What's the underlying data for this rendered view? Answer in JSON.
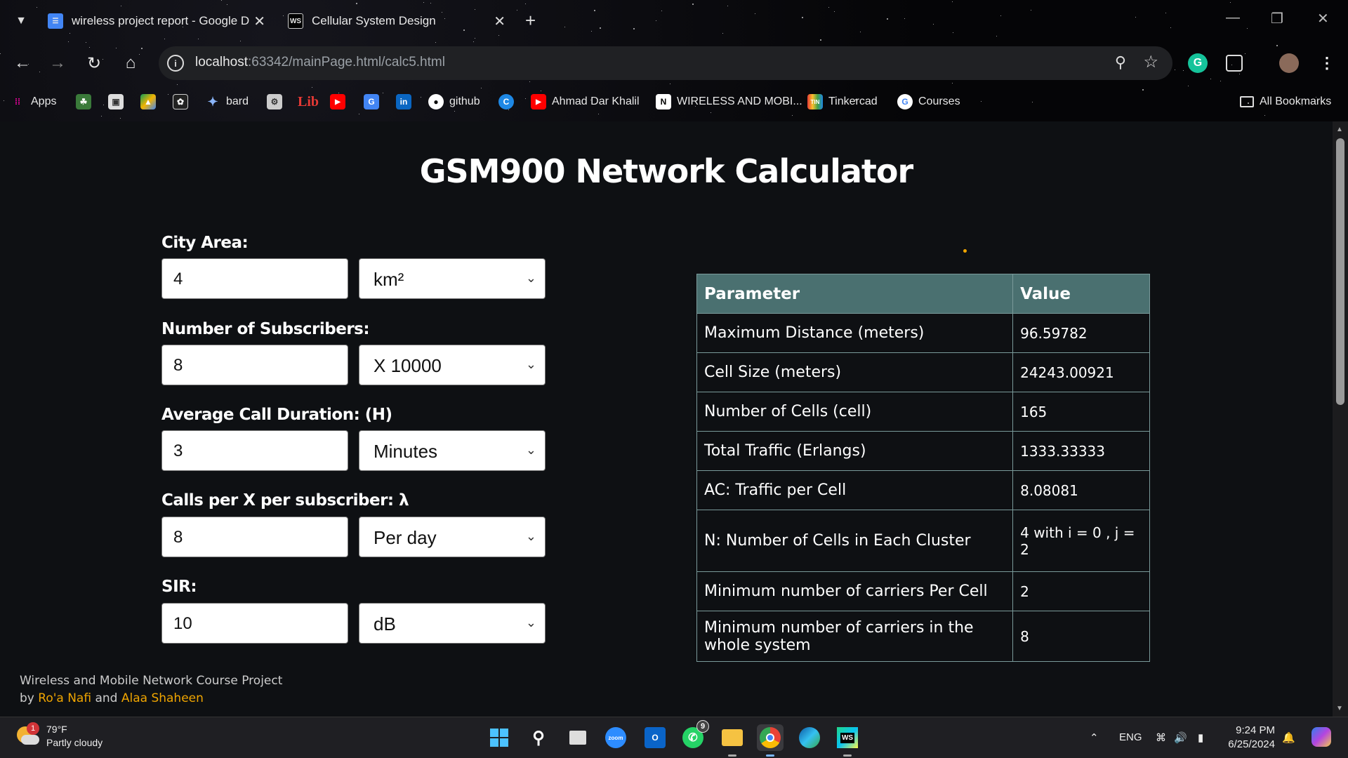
{
  "browser": {
    "tabs": [
      {
        "title": "wireless project report - Google D",
        "icon": "google-docs-icon"
      },
      {
        "title": "Cellular System Design",
        "icon": "webstorm-icon"
      }
    ],
    "url_host": "localhost",
    "url_path": ":63342/mainPage.html/calc5.html",
    "bookmarks": [
      {
        "label": "Apps",
        "icon": "apps-grid-icon"
      },
      {
        "label": "bard",
        "icon": "sparkle-icon"
      },
      {
        "label": "Lib",
        "icon": "lib-icon"
      },
      {
        "label": "github",
        "icon": "github-icon"
      },
      {
        "label": "Ahmad Dar Khalil",
        "icon": "youtube-icon"
      },
      {
        "label": "WIRELESS AND MOBI...",
        "icon": "notion-icon"
      },
      {
        "label": "Tinkercad",
        "icon": "tinkercad-icon"
      },
      {
        "label": "Courses",
        "icon": "google-icon"
      },
      {
        "label": "All Bookmarks",
        "icon": "folder-icon"
      }
    ]
  },
  "page": {
    "title": "GSM900 Network Calculator",
    "fields": [
      {
        "label": "City Area:",
        "value": "4",
        "unit": "km²"
      },
      {
        "label": "Number of Subscribers:",
        "value": "8",
        "unit": "X 10000"
      },
      {
        "label": "Average Call Duration: (H)",
        "value": "3",
        "unit": "Minutes"
      },
      {
        "label": "Calls per X per subscriber: λ",
        "value": "8",
        "unit": "Per day"
      },
      {
        "label": "SIR:",
        "value": "10",
        "unit": "dB"
      }
    ],
    "table": {
      "headers": [
        "Parameter",
        "Value"
      ],
      "rows": [
        [
          "Maximum Distance (meters)",
          "96.59782"
        ],
        [
          "Cell Size (meters)",
          "24243.00921"
        ],
        [
          "Number of Cells (cell)",
          "165"
        ],
        [
          "Total Traffic (Erlangs)",
          "1333.33333"
        ],
        [
          "AC: Traffic per Cell",
          "8.08081"
        ],
        [
          "N: Number of Cells in Each Cluster",
          "4 with i = 0 , j = 2"
        ],
        [
          "Minimum number of carriers Per Cell",
          "2"
        ],
        [
          "Minimum number of carriers in the whole system",
          "8"
        ]
      ]
    },
    "footer": {
      "line1": "Wireless and Mobile Network Course Project",
      "by": "by",
      "author1": "Ro'a Nafi",
      "and": "and",
      "author2": "Alaa Shaheen"
    }
  },
  "taskbar": {
    "weather_temp": "79°F",
    "weather_desc": "Partly cloudy",
    "weather_badge": "1",
    "whatsapp_badge": "9",
    "language": "ENG",
    "time": "9:24 PM",
    "date": "6/25/2024"
  },
  "colors": {
    "page_bg": "#0e1013",
    "table_header": "#4a7070",
    "accent_name": "#f0a500"
  }
}
